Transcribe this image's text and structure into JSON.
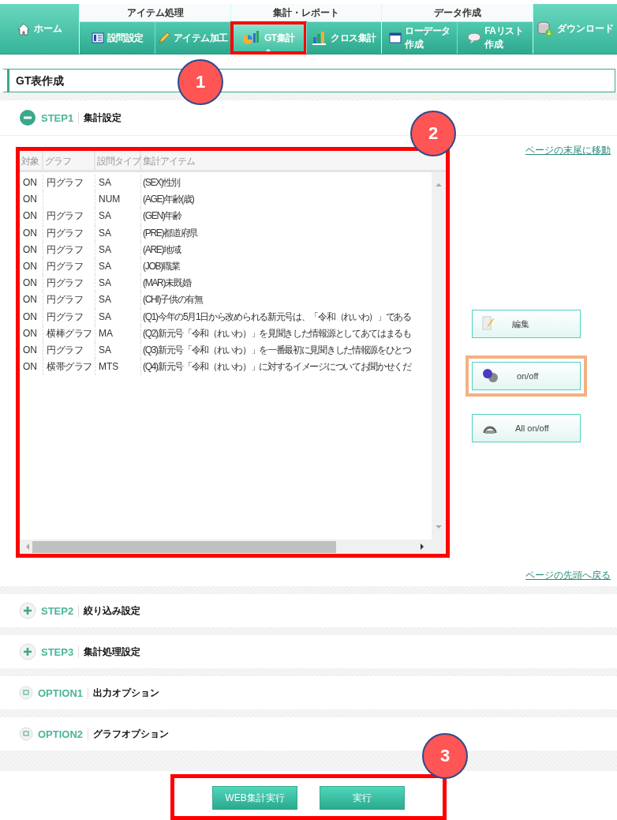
{
  "nav": {
    "home": {
      "label": "ホーム"
    },
    "groups": [
      {
        "title": "アイテム処理",
        "tabs": [
          {
            "lines": [
              "設問設定"
            ],
            "selected": false,
            "highlighted": false
          },
          {
            "lines": [
              "アイテム加工"
            ],
            "selected": false,
            "highlighted": false
          }
        ]
      },
      {
        "title": "集計・レポート",
        "tabs": [
          {
            "lines": [
              "GT集計"
            ],
            "selected": true,
            "highlighted": true
          },
          {
            "lines": [
              "クロス集計"
            ],
            "selected": false,
            "highlighted": false
          }
        ]
      },
      {
        "title": "データ作成",
        "tabs": [
          {
            "lines": [
              "ローデータ",
              "作成"
            ],
            "selected": false,
            "highlighted": false
          },
          {
            "lines": [
              "FAリスト",
              "作成"
            ],
            "selected": false,
            "highlighted": false
          }
        ]
      }
    ],
    "download": {
      "label": "ダウンロード"
    }
  },
  "page_title": "GT表作成",
  "sections": [
    {
      "kind": "step",
      "code": "STEP1",
      "title": "集計設定",
      "expanded": true
    },
    {
      "kind": "step",
      "code": "STEP2",
      "title": "絞り込み設定",
      "expanded": false
    },
    {
      "kind": "step",
      "code": "STEP3",
      "title": "集計処理設定",
      "expanded": false
    },
    {
      "kind": "option",
      "code": "OPTION1",
      "title": "出力オプション",
      "expanded": false
    },
    {
      "kind": "option",
      "code": "OPTION2",
      "title": "グラフオプション",
      "expanded": false
    }
  ],
  "link_bottom": "ページの末尾に移動",
  "link_top": "ページの先頭へ戻る",
  "table": {
    "highlighted": true,
    "columns": [
      "対象",
      "グラフ",
      "設問タイプ",
      "集計アイテム"
    ],
    "rows": [
      [
        "ON",
        "円グラフ",
        "SA",
        "(SEX)性別"
      ],
      [
        "ON",
        "",
        "NUM",
        "(AGE)年齢(歳)"
      ],
      [
        "ON",
        "円グラフ",
        "SA",
        "(GEN)年齢"
      ],
      [
        "ON",
        "円グラフ",
        "SA",
        "(PRE)都道府県"
      ],
      [
        "ON",
        "円グラフ",
        "SA",
        "(ARE)地域"
      ],
      [
        "ON",
        "円グラフ",
        "SA",
        "(JOB)職業"
      ],
      [
        "ON",
        "円グラフ",
        "SA",
        "(MAR)未既婚"
      ],
      [
        "ON",
        "円グラフ",
        "SA",
        "(CHI)子供の有無"
      ],
      [
        "ON",
        "円グラフ",
        "SA",
        "(Q1)今年の5月1日から改められる新元号は、「令和（れいわ）」である"
      ],
      [
        "ON",
        "横棒グラフ",
        "MA",
        "(Q2)新元号「令和（れいわ）」を見聞きした情報源としてあてはまるも"
      ],
      [
        "ON",
        "円グラフ",
        "SA",
        "(Q3)新元号「令和（れいわ）」を一番最初に見聞きした情報源をひとつ"
      ],
      [
        "ON",
        "横帯グラフ",
        "MTS",
        "(Q4)新元号「令和（れいわ）」に対するイメージについてお聞かせくだ"
      ]
    ]
  },
  "side_buttons": [
    {
      "label": "編集",
      "highlighted": false
    },
    {
      "label": "on/off",
      "highlighted": true
    },
    {
      "label": "All on/off",
      "highlighted": false
    }
  ],
  "actions": {
    "highlighted": true,
    "buttons": [
      "WEB集計実行",
      "実行"
    ]
  },
  "callouts": [
    "1",
    "2",
    "3"
  ]
}
